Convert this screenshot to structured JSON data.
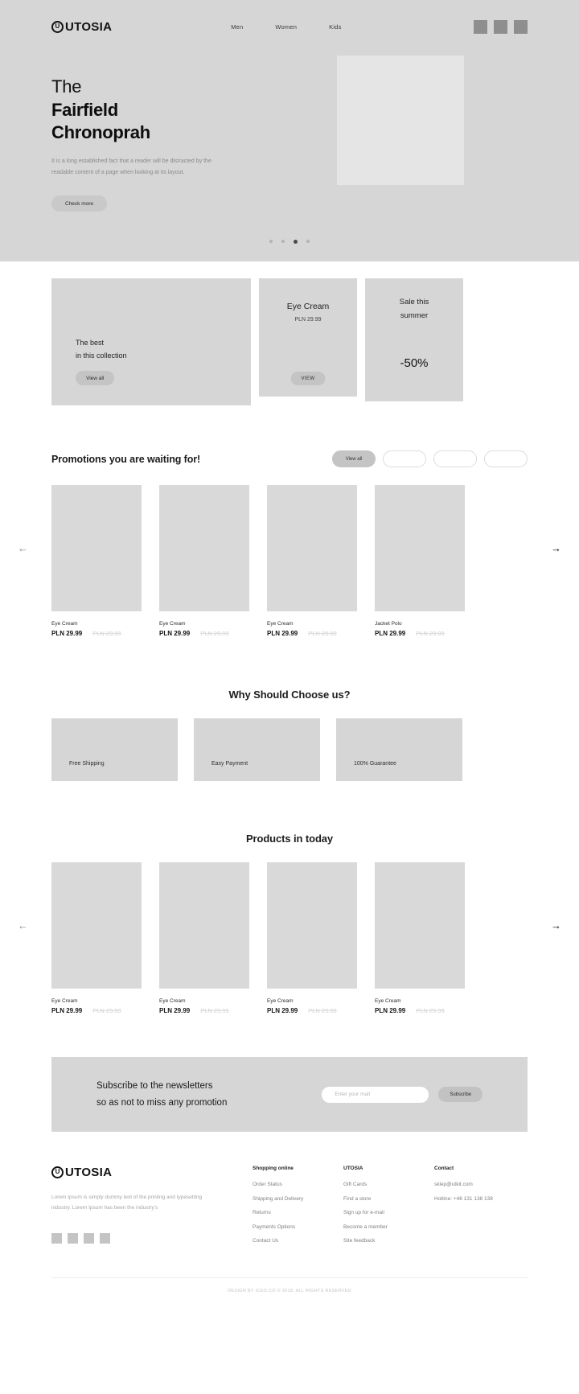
{
  "header": {
    "logo_text": "UTOSIA",
    "logo_mark": "U",
    "nav": [
      {
        "label": "Men"
      },
      {
        "label": "Women"
      },
      {
        "label": "Kids"
      }
    ],
    "icons": [
      {
        "name": "search-icon"
      },
      {
        "name": "user-icon"
      },
      {
        "name": "cart-icon"
      }
    ]
  },
  "hero": {
    "line1": "The",
    "line2": "Fairfield",
    "line3": "Chronoprah",
    "description": "It is a long established fact that a reader will be distracted by the readable content of a page when looking at its layout.",
    "button_label": "Check more",
    "dots": 4,
    "active_dot": 3
  },
  "promos": {
    "big": {
      "line1": "The best",
      "line2": "in this collection",
      "button_label": "View all"
    },
    "mid": {
      "title": "Eye Cream",
      "price": "PLN 29.99",
      "button_label": "VIEW"
    },
    "small": {
      "line1": "Sale this",
      "line2": "summer",
      "discount": "-50%"
    }
  },
  "promotions_section": {
    "title": "Promotions you are waiting for!",
    "filters": [
      {
        "label": "View all",
        "active": true
      },
      {
        "label": "",
        "active": false
      },
      {
        "label": "",
        "active": false
      },
      {
        "label": "",
        "active": false
      }
    ],
    "prev_arrow": "←",
    "next_arrow": "→",
    "products": [
      {
        "name": "Eye Cream",
        "price": "PLN 29.99",
        "old_price": "PLN 29.99"
      },
      {
        "name": "Eye Cream",
        "price": "PLN 29.99",
        "old_price": "PLN 29.99"
      },
      {
        "name": "Eye Cream",
        "price": "PLN 29.99",
        "old_price": "PLN 29.99"
      },
      {
        "name": "Jacket Polo",
        "price": "PLN 29.99",
        "old_price": "PLN 29.99"
      }
    ]
  },
  "why_section": {
    "title": "Why Should Choose us?",
    "features": [
      {
        "label": "Free Shipping"
      },
      {
        "label": "Easy Payment"
      },
      {
        "label": "100% Guarantee"
      }
    ]
  },
  "today_section": {
    "title": "Products in today",
    "prev_arrow": "←",
    "next_arrow": "→",
    "products": [
      {
        "name": "Eye Cream",
        "price": "PLN 29.99",
        "old_price": "PLN 29.99"
      },
      {
        "name": "Eye Cream",
        "price": "PLN 29.99",
        "old_price": "PLN 29.99"
      },
      {
        "name": "Eye Cream",
        "price": "PLN 29.99",
        "old_price": "PLN 29.99"
      },
      {
        "name": "Eye Cream",
        "price": "PLN 29.99",
        "old_price": "PLN 29.99"
      }
    ]
  },
  "newsletter": {
    "line1": "Subscribe to the newsletters",
    "line2": "so as not to miss any promotion",
    "placeholder": "Enter your mail",
    "input_value": "",
    "button_label": "Subscribe"
  },
  "footer": {
    "logo_text": "UTOSIA",
    "logo_mark": "U",
    "about": "Lorem Ipsum is simply dummy text of the printing and typesetting industry. Lorem Ipsum has been the industry's",
    "socials": [
      {
        "name": "facebook-icon"
      },
      {
        "name": "twitter-icon"
      },
      {
        "name": "instagram-icon"
      },
      {
        "name": "youtube-icon"
      }
    ],
    "columns": [
      {
        "title": "Shopping online",
        "links": [
          "Order Status",
          "Shipping and Delivery",
          "Returns",
          "Payments Options",
          "Contact Us"
        ]
      },
      {
        "title": "UTOSIA",
        "links": [
          "Gift Cards",
          "Find a store",
          "Sign up for e-mail",
          "Become a member",
          "Site feedback"
        ]
      },
      {
        "title": "Contact",
        "links": [
          "sklep@utkit.com",
          "Hotline: +46 131 138 138"
        ]
      }
    ],
    "copyright": "DESIGN BY ICEO.CO  ©  2018. ALL RIGHTS RESERVED"
  },
  "colors": {
    "page_bg": "#ffffff",
    "hero_bg": "#d6d6d6",
    "placeholder": "#d9d9d9",
    "accent": "#c4c4c4",
    "muted_text": "#8a8a8a"
  }
}
